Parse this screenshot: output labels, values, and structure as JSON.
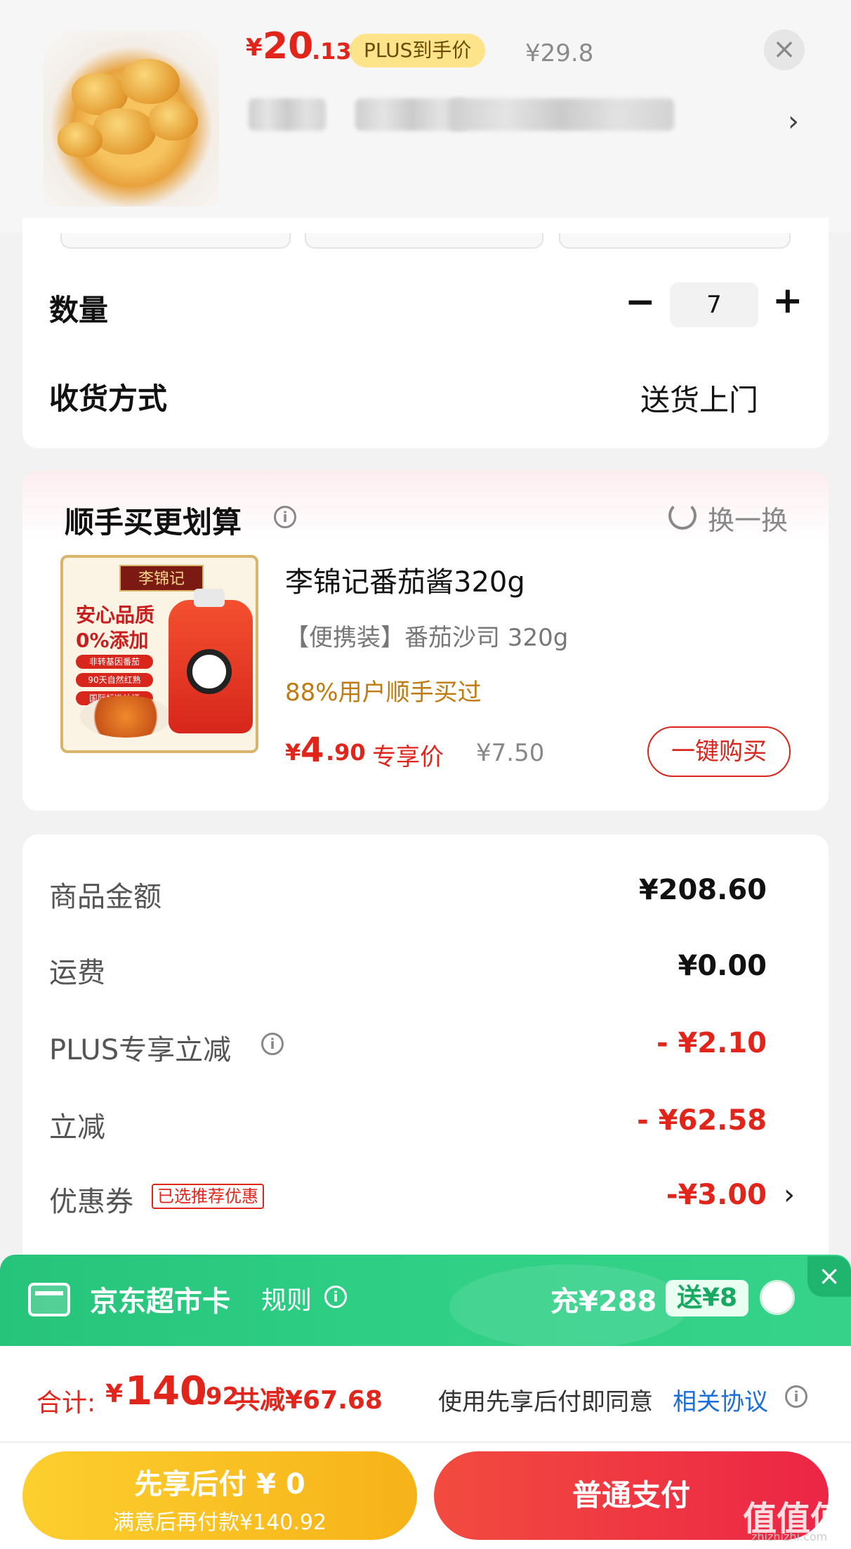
{
  "header": {
    "price_currency": "¥",
    "price_int": "20",
    "price_dec": ".13",
    "plus_tag": "PLUS到手价",
    "original_price": "¥29.8",
    "close_icon": "close-icon",
    "chevron_icon": "chevron-right-icon"
  },
  "purchase": {
    "quantity_label": "数量",
    "quantity_minus": "−",
    "quantity_value": "7",
    "quantity_plus": "+",
    "delivery_label": "收货方式",
    "delivery_value": "送货上门"
  },
  "cross_sell": {
    "title": "顺手买更划算",
    "refresh_label": "换一换",
    "image": {
      "brand": "李锦记",
      "line1": "安心品质",
      "line2": "0%添加",
      "tags": [
        "非转基因番茄",
        "90天自然红熟",
        "国际标准认证"
      ]
    },
    "product_name": "李锦记番茄酱320g",
    "product_sub": "【便携装】番茄沙司 320g",
    "hint": "88%用户顺手买过",
    "price_currency": "¥",
    "price_int": "4",
    "price_dec": ".90",
    "exclusive_label": "专享价",
    "original_price": "¥7.50",
    "buy_button": "一键购买"
  },
  "summary": {
    "rows": [
      {
        "label": "商品金额",
        "value": "¥208.60"
      },
      {
        "label": "运费",
        "value": "¥0.00"
      },
      {
        "label": "PLUS专享立减",
        "value": "- ¥2.10"
      },
      {
        "label": "立减",
        "value": "- ¥62.58"
      },
      {
        "label": "优惠券",
        "value": "-¥3.00"
      }
    ],
    "coupon_tag": "已选推荐优惠"
  },
  "supermarket_card": {
    "title": "京东超市卡",
    "rule_label": "规则",
    "charge": "充¥288",
    "gift": "送¥8",
    "close": "×"
  },
  "bottom": {
    "total_label": "合计:",
    "total_currency": "¥",
    "total_int": "140",
    "total_dec": ".92",
    "total_saved": "共减¥67.68",
    "agree_text": "使用先享后付即同意",
    "agree_link": "相关协议",
    "pay_later_main": "先享后付 ¥ 0",
    "pay_later_sub": "满意后再付款¥140.92",
    "pay_normal": "普通支付",
    "watermark": "值值值",
    "watermark_sub": "zhizhizhi.com"
  },
  "colors": {
    "accent_red": "#e1251b",
    "plus_gold": "#fde48a",
    "green": "#2fd086",
    "pay_later_yellow": "#f7b319",
    "link_blue": "#1b6fd8"
  }
}
